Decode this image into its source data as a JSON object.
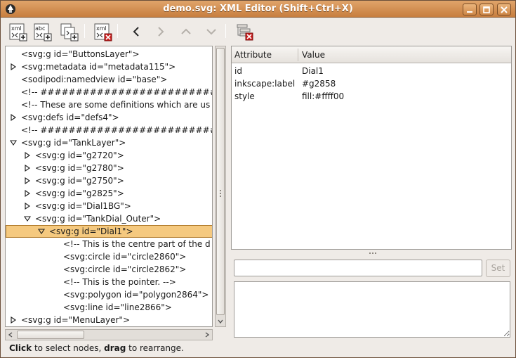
{
  "window": {
    "title": "demo.svg: XML Editor (Shift+Ctrl+X)"
  },
  "toolbar": {
    "new_element_icon_text": "xml",
    "new_text_icon_text": "abc",
    "delete_icon_text": "xml"
  },
  "tree": {
    "rows": [
      {
        "text": "<svg:g id=\"ButtonsLayer\">",
        "indent": 1,
        "expander": "none"
      },
      {
        "text": "<svg:metadata id=\"metadata115\">",
        "indent": 1,
        "expander": "collapsed"
      },
      {
        "text": "<sodipodi:namedview id=\"base\">",
        "indent": 1,
        "expander": "none"
      },
      {
        "text": "<!-- ##################################",
        "indent": 1,
        "expander": "none"
      },
      {
        "text": "<!-- These are some definitions which are us",
        "indent": 1,
        "expander": "none"
      },
      {
        "text": "<svg:defs id=\"defs4\">",
        "indent": 1,
        "expander": "collapsed"
      },
      {
        "text": "<!-- ##################################",
        "indent": 1,
        "expander": "none"
      },
      {
        "text": "<svg:g id=\"TankLayer\">",
        "indent": 1,
        "expander": "expanded"
      },
      {
        "text": "<svg:g id=\"g2720\">",
        "indent": 2,
        "expander": "collapsed"
      },
      {
        "text": "<svg:g id=\"g2780\">",
        "indent": 2,
        "expander": "collapsed"
      },
      {
        "text": "<svg:g id=\"g2750\">",
        "indent": 2,
        "expander": "collapsed"
      },
      {
        "text": "<svg:g id=\"g2825\">",
        "indent": 2,
        "expander": "collapsed"
      },
      {
        "text": "<svg:g id=\"Dial1BG\">",
        "indent": 2,
        "expander": "collapsed"
      },
      {
        "text": "<svg:g id=\"TankDial_Outer\">",
        "indent": 2,
        "expander": "expanded"
      },
      {
        "text": "<svg:g id=\"Dial1\">",
        "indent": 3,
        "expander": "expanded",
        "selected": true
      },
      {
        "text": "<!-- This is the centre part of the d",
        "indent": 4,
        "expander": "none"
      },
      {
        "text": "<svg:circle id=\"circle2860\">",
        "indent": 4,
        "expander": "none"
      },
      {
        "text": "<svg:circle id=\"circle2862\">",
        "indent": 4,
        "expander": "none"
      },
      {
        "text": "<!-- This is the pointer. -->",
        "indent": 4,
        "expander": "none"
      },
      {
        "text": "<svg:polygon id=\"polygon2864\">",
        "indent": 4,
        "expander": "none"
      },
      {
        "text": "<svg:line id=\"line2866\">",
        "indent": 4,
        "expander": "none"
      },
      {
        "text": "<svg:g id=\"MenuLayer\">",
        "indent": 1,
        "expander": "collapsed"
      }
    ]
  },
  "attributes": {
    "header_attribute": "Attribute",
    "header_value": "Value",
    "rows": [
      {
        "name": "id",
        "value": "Dial1"
      },
      {
        "name": "inkscape:label",
        "value": "#g2858"
      },
      {
        "name": "style",
        "value": "fill:#ffff00"
      }
    ]
  },
  "editor": {
    "set_label": "Set",
    "attr_name_value": "",
    "attr_value_text": ""
  },
  "status": {
    "click_word": "Click",
    "mid_text": " to select nodes, ",
    "drag_word": "drag",
    "end_text": " to rearrange."
  },
  "colors": {
    "titlebar": "#d08a48",
    "selection": "#f5c97f",
    "delete_accent": "#cc1f1f"
  }
}
